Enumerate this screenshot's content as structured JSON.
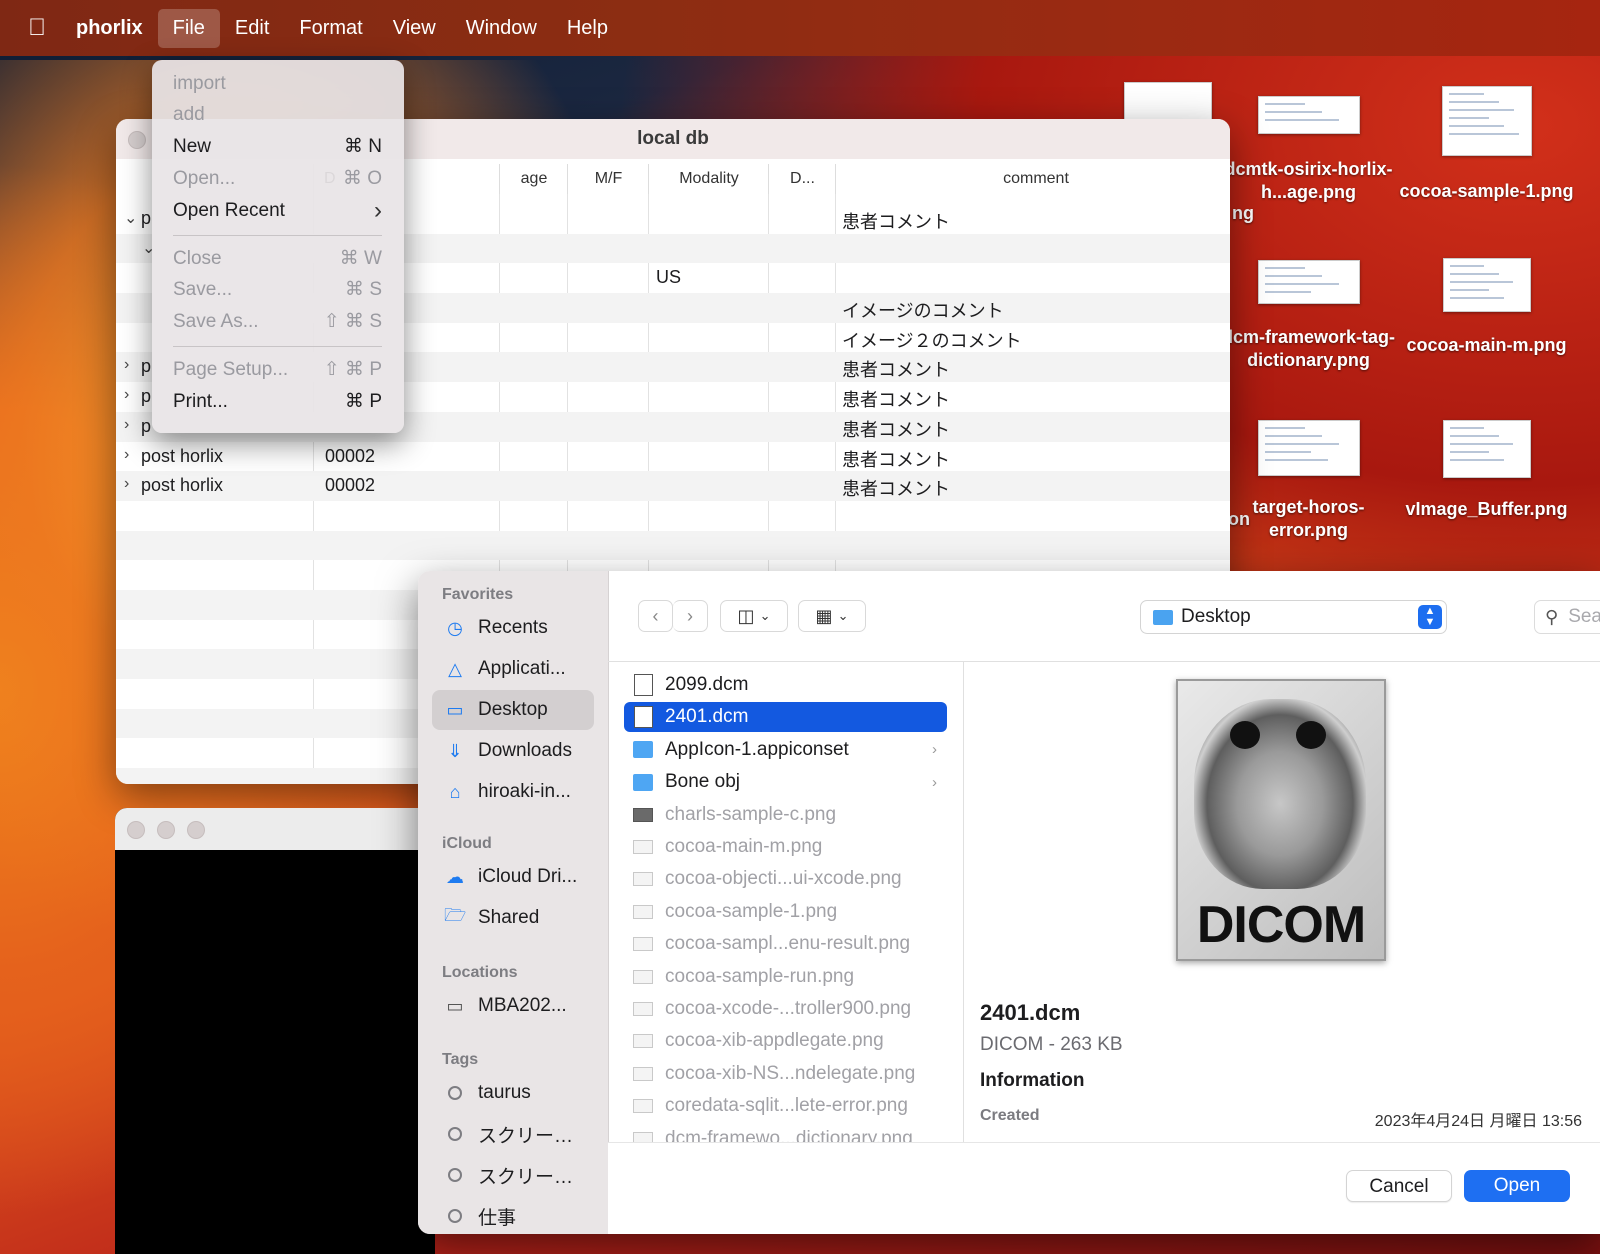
{
  "menubar": {
    "app_name": "phorlix",
    "items": [
      "File",
      "Edit",
      "Format",
      "View",
      "Window",
      "Help"
    ],
    "active": "File"
  },
  "file_menu": {
    "items": [
      {
        "label": "import",
        "shortcut": "",
        "disabled": true
      },
      {
        "label": "add",
        "shortcut": "",
        "disabled": true
      },
      {
        "label": "New",
        "shortcut": "⌘ N",
        "disabled": false
      },
      {
        "label": "Open...",
        "shortcut": "⌘ O",
        "disabled": true
      },
      {
        "label": "Open Recent",
        "shortcut": "›",
        "disabled": false
      },
      {
        "label": "Close",
        "shortcut": "⌘ W",
        "disabled": true
      },
      {
        "label": "Save...",
        "shortcut": "⌘ S",
        "disabled": true
      },
      {
        "label": "Save As...",
        "shortcut": "⇧ ⌘ S",
        "disabled": true
      },
      {
        "label": "Page Setup...",
        "shortcut": "⇧ ⌘ P",
        "disabled": true
      },
      {
        "label": "Print...",
        "shortcut": "⌘ P",
        "disabled": false
      }
    ]
  },
  "db_window": {
    "title": "local db",
    "columns": [
      "age",
      "M/F",
      "Modality",
      "D...",
      "comment"
    ],
    "rows": [
      {
        "name": "p",
        "id": "",
        "modality": "",
        "comment": "患者コメント",
        "chevron": "⌄"
      },
      {
        "name": "",
        "id": "",
        "modality": "",
        "comment": "",
        "chevron": "⌄"
      },
      {
        "name": "",
        "id": "",
        "modality": "US",
        "comment": "",
        "chevron": ""
      },
      {
        "name": "",
        "id": "",
        "modality": "",
        "comment": "イメージのコメント",
        "chevron": ""
      },
      {
        "name": "",
        "id": "",
        "modality": "",
        "comment": "イメージ２のコメント",
        "chevron": ""
      },
      {
        "name": "p",
        "id": "",
        "modality": "",
        "comment": "患者コメント",
        "chevron": "›"
      },
      {
        "name": "p",
        "id": "",
        "modality": "",
        "comment": "患者コメント",
        "chevron": "›"
      },
      {
        "name": "p",
        "id": "",
        "modality": "",
        "comment": "患者コメント",
        "chevron": "›"
      },
      {
        "name": "post horlix",
        "id": "00002",
        "modality": "",
        "comment": "患者コメント",
        "chevron": "›"
      },
      {
        "name": "post horlix",
        "id": "00002",
        "modality": "",
        "comment": "患者コメント",
        "chevron": "›"
      }
    ]
  },
  "desktop_icons": [
    {
      "label": "dcmtk-osirix-horlix-h...age.png"
    },
    {
      "label": "cocoa-sample-1.png"
    },
    {
      "label": "dcm-framework-tag-dictionary.png"
    },
    {
      "label": "cocoa-main-m.png"
    },
    {
      "label": "target-horos-error.png"
    },
    {
      "label": "vImage_Buffer.png"
    }
  ],
  "desktop_partial_labels": [
    "ng",
    "on"
  ],
  "open_panel": {
    "sidebar": {
      "favorites_header": "Favorites",
      "favorites": [
        {
          "label": "Recents",
          "icon": "clock-icon"
        },
        {
          "label": "Applicati...",
          "icon": "applications-icon"
        },
        {
          "label": "Desktop",
          "icon": "desktop-icon",
          "selected": true
        },
        {
          "label": "Downloads",
          "icon": "download-icon"
        },
        {
          "label": "hiroaki-in...",
          "icon": "home-icon"
        }
      ],
      "icloud_header": "iCloud",
      "icloud": [
        {
          "label": "iCloud Dri...",
          "icon": "cloud-icon"
        },
        {
          "label": "Shared",
          "icon": "shared-folder-icon"
        }
      ],
      "locations_header": "Locations",
      "locations": [
        {
          "label": "MBA202...",
          "icon": "laptop-icon"
        }
      ],
      "tags_header": "Tags",
      "tags": [
        {
          "label": "taurus"
        },
        {
          "label": "スクリー…"
        },
        {
          "label": "スクリー…"
        },
        {
          "label": "仕事"
        }
      ]
    },
    "location": "Desktop",
    "search_placeholder": "Search",
    "files": [
      {
        "name": "2099.dcm",
        "type": "dcm"
      },
      {
        "name": "2401.dcm",
        "type": "dcm",
        "selected": true
      },
      {
        "name": "AppIcon-1.appiconset",
        "type": "folder"
      },
      {
        "name": "Bone obj",
        "type": "folder"
      },
      {
        "name": "charls-sample-c.png",
        "type": "png-dark"
      },
      {
        "name": "cocoa-main-m.png",
        "type": "png"
      },
      {
        "name": "cocoa-objecti...ui-xcode.png",
        "type": "png"
      },
      {
        "name": "cocoa-sample-1.png",
        "type": "png"
      },
      {
        "name": "cocoa-sampl...enu-result.png",
        "type": "png"
      },
      {
        "name": "cocoa-sample-run.png",
        "type": "png"
      },
      {
        "name": "cocoa-xcode-...troller900.png",
        "type": "png"
      },
      {
        "name": "cocoa-xib-appdlegate.png",
        "type": "png"
      },
      {
        "name": "cocoa-xib-NS...ndelegate.png",
        "type": "png"
      },
      {
        "name": "coredata-sqlit...lete-error.png",
        "type": "png"
      },
      {
        "name": "dcm-framewo...dictionary.png",
        "type": "png"
      }
    ],
    "preview": {
      "icon_text": "DICOM",
      "name": "2401.dcm",
      "kind": "DICOM - 263 KB",
      "info_header": "Information",
      "created_label": "Created",
      "created_value": "2023年4月24日 月曜日 13:56"
    },
    "buttons": {
      "cancel": "Cancel",
      "open": "Open"
    }
  }
}
